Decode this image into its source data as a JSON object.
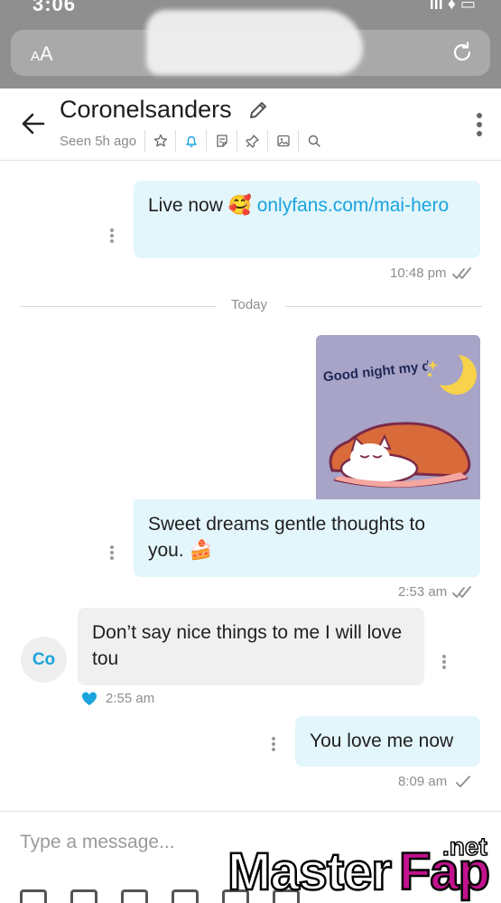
{
  "status_bar": {
    "time": "3:06",
    "icons": "lll ♦ ▭"
  },
  "browser": {
    "text_size_label_small": "A",
    "text_size_label_large": "A"
  },
  "header": {
    "contact_name": "Coronelsanders",
    "seen": "Seen 5h ago"
  },
  "messages": [
    {
      "id": "m1",
      "direction": "outgoing",
      "text_prefix": "Live now 🥰 ",
      "link": "onlyfans.com/mai-hero",
      "time": "10:48 pm",
      "status": "read"
    },
    {
      "id": "m2",
      "direction": "outgoing",
      "sticker_text": "Good night my dear!",
      "text": "Sweet dreams gentle thoughts to you. 🍰",
      "time": "2:53 am",
      "status": "read"
    },
    {
      "id": "m3",
      "direction": "incoming",
      "text": "Don’t say nice things to me I will love tou",
      "time": "2:55 am",
      "liked": true
    },
    {
      "id": "m4",
      "direction": "outgoing",
      "text": "You love me now",
      "time": "8:09 am",
      "status": "sent"
    }
  ],
  "divider": {
    "label": "Today"
  },
  "avatar": {
    "initials": "Co"
  },
  "composer": {
    "placeholder": "Type a message..."
  },
  "watermark": {
    "master": "Master",
    "fap": "Fap",
    "net": ".net"
  },
  "colors": {
    "accent": "#1aa4dd",
    "outgoing_bubble": "#e3f6fc",
    "incoming_bubble": "#f0f0f0",
    "heart": "#1aa4dd"
  },
  "icons": [
    "back-arrow-icon",
    "edit-pencil-icon",
    "star-icon",
    "bell-icon",
    "note-icon",
    "pin-icon",
    "image-icon",
    "search-icon",
    "more-vertical-icon",
    "reload-icon",
    "double-check-icon",
    "single-check-icon",
    "heart-icon"
  ]
}
